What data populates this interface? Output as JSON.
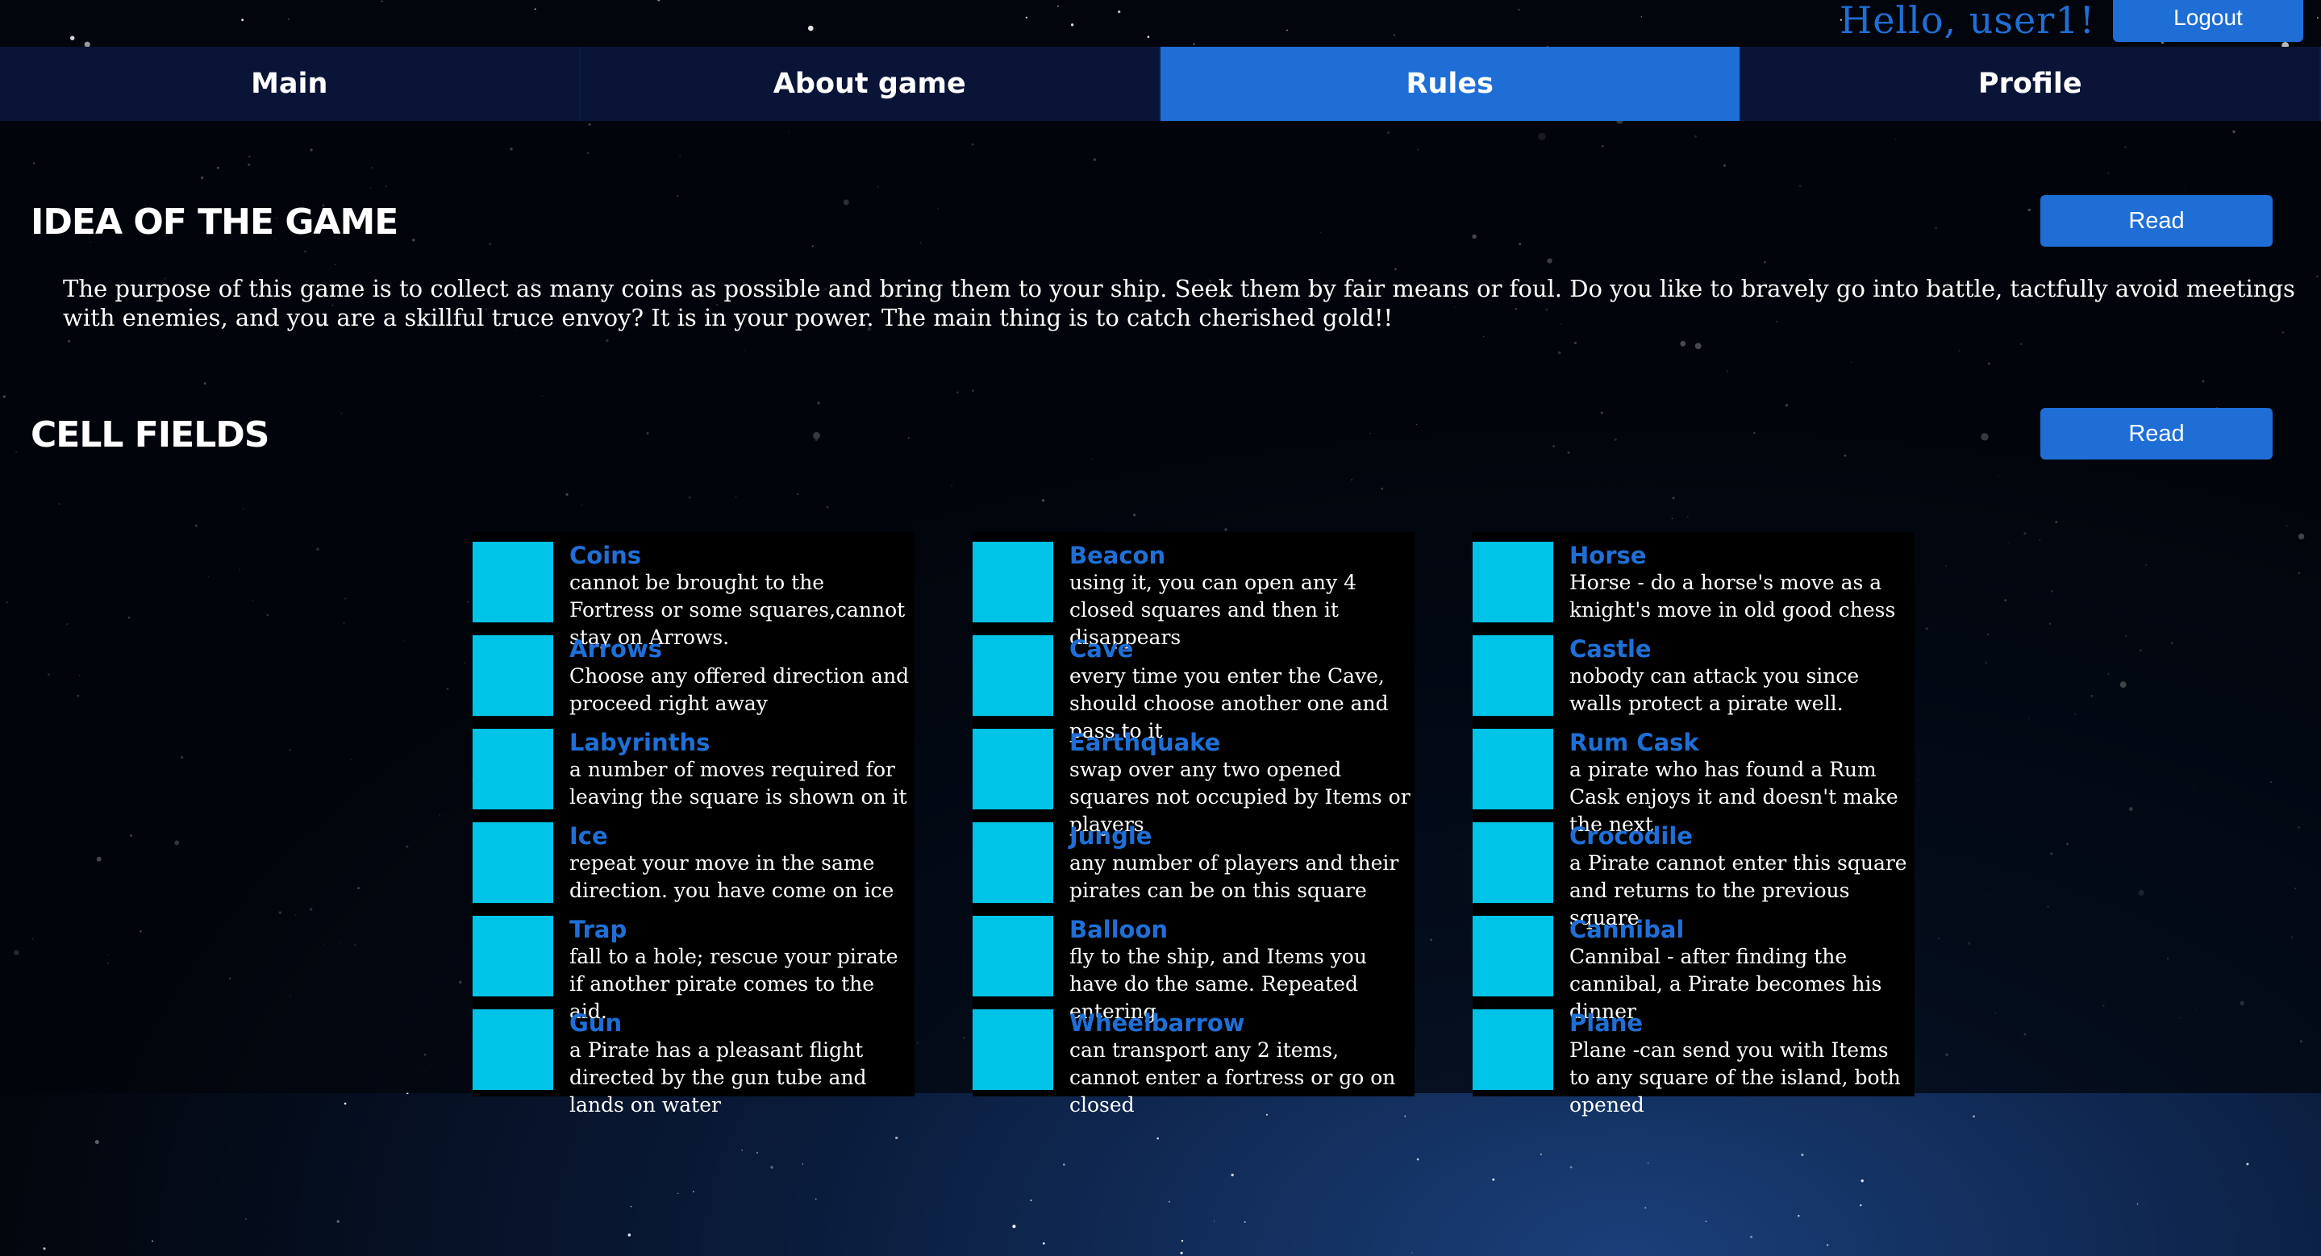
{
  "header": {
    "greeting": "Hello, user1!",
    "logout_label": "Logout"
  },
  "nav": {
    "tabs": [
      {
        "label": "Main"
      },
      {
        "label": "About game"
      },
      {
        "label": "Rules"
      },
      {
        "label": "Profile"
      }
    ],
    "active_tab": "Rules"
  },
  "sections": {
    "idea": {
      "title": "IDEA OF THE GAME",
      "read_label": "Read",
      "text": "The purpose of this game is to collect as many coins as possible and bring them to your ship. Seek them by fair means or foul. Do you like to bravely go into battle, tactfully avoid meetings with enemies, and you are a skillful truce envoy? It is in your power. The main thing is to catch cherished gold!!"
    },
    "cells": {
      "title": "CELL FIELDS",
      "read_label": "Read",
      "columns": [
        {
          "items": [
            {
              "name": "Coins",
              "desc": "cannot be brought to the Fortress or some squares,cannot stay on Arrows."
            },
            {
              "name": "Arrows",
              "desc": "Choose any offered direction and proceed right away"
            },
            {
              "name": "Labyrinths",
              "desc": "a number of moves required for leaving the square is shown on it"
            },
            {
              "name": "Ice",
              "desc": "repeat your move in the same direction. you have come on ice"
            },
            {
              "name": "Trap",
              "desc": "fall to a hole; rescue your pirate if another pirate comes to the aid."
            },
            {
              "name": "Gun",
              "desc": "a Pirate has a pleasant flight directed by the gun tube and lands on water"
            }
          ]
        },
        {
          "items": [
            {
              "name": "Beacon",
              "desc": "using it, you can open any 4 closed squares and then it disappears"
            },
            {
              "name": "Cave",
              "desc": "every time you enter the Cave, should choose another one and pass to it"
            },
            {
              "name": "Earthquake",
              "desc": "swap over any two opened squares not occupied by Items or players"
            },
            {
              "name": "Jungle",
              "desc": "any number of players and their pirates can be on this square"
            },
            {
              "name": "Balloon",
              "desc": "fly to the ship, and Items you have do the same. Repeated entering"
            },
            {
              "name": "Wheelbarrow",
              "desc": "can transport any 2 items, cannot enter a fortress or go on closed"
            }
          ]
        },
        {
          "items": [
            {
              "name": "Horse",
              "desc": "Horse - do a horse's move as a knight's move in old good chess"
            },
            {
              "name": "Castle",
              "desc": "nobody can attack you since walls protect a pirate well."
            },
            {
              "name": "Rum Cask",
              "desc": "a pirate who has found a Rum Cask enjoys it and doesn't make the next."
            },
            {
              "name": "Crocodile",
              "desc": "a Pirate cannot enter this square and returns to the previous square"
            },
            {
              "name": "Cannibal",
              "desc": "Cannibal - after finding the cannibal, a Pirate becomes his dinner"
            },
            {
              "name": "Plane",
              "desc": "Plane -can send you with Items to any square of the island, both opened"
            }
          ]
        }
      ]
    }
  },
  "colors": {
    "accent": "#1e6ed6",
    "cell_swatch": "#00c3e8",
    "nav_bg": "#0a1436",
    "background": "#02050c"
  }
}
